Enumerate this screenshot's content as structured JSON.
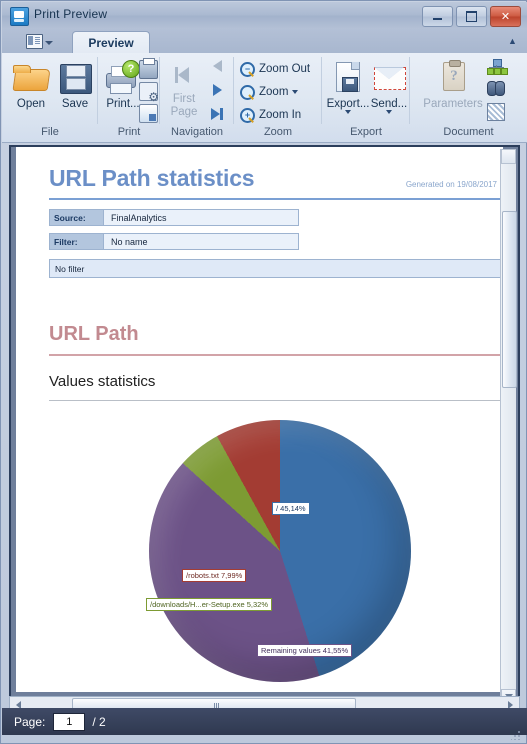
{
  "window": {
    "title": "Print Preview",
    "icon": "print-preview-icon",
    "minimize_label": "–",
    "maximize_label": "□",
    "close_label": "✕"
  },
  "ribbon": {
    "quick_access_icon": "document-layout-icon",
    "collapse_label": "▲",
    "tabs": [
      {
        "label": "Preview",
        "active": true
      }
    ],
    "groups": [
      {
        "name": "File",
        "label": "File",
        "buttons": [
          {
            "label": "Open",
            "icon": "open-folder-icon"
          },
          {
            "label": "Save",
            "icon": "floppy-disk-icon"
          }
        ]
      },
      {
        "name": "Print",
        "label": "Print",
        "buttons": [
          {
            "label": "Print...",
            "icon": "printer-icon"
          }
        ],
        "small_buttons": [
          {
            "icon": "quick-print-icon"
          },
          {
            "icon": "page-setup-gear-icon"
          },
          {
            "icon": "scale-icon"
          }
        ]
      },
      {
        "name": "Navigation",
        "label": "Navigation",
        "buttons": [
          {
            "label": "First Page",
            "icon": "first-page-icon",
            "disabled": true
          }
        ],
        "small_buttons": [
          {
            "icon": "previous-page-icon",
            "disabled": true
          },
          {
            "icon": "next-page-icon",
            "disabled": false
          },
          {
            "icon": "last-page-icon",
            "disabled": false
          }
        ]
      },
      {
        "name": "Zoom",
        "label": "Zoom",
        "rows": [
          {
            "label": "Zoom Out",
            "icon": "zoom-out-icon",
            "glyph": "−",
            "dropdown": false
          },
          {
            "label": "Zoom",
            "icon": "zoom-icon",
            "glyph": "",
            "dropdown": true
          },
          {
            "label": "Zoom In",
            "icon": "zoom-in-icon",
            "glyph": "+",
            "dropdown": false
          }
        ]
      },
      {
        "name": "Export",
        "label": "Export",
        "buttons": [
          {
            "label": "Export...",
            "icon": "export-document-icon",
            "dropdown": true
          },
          {
            "label": "Send...",
            "icon": "send-mail-icon",
            "dropdown": true
          }
        ]
      },
      {
        "name": "Document",
        "label": "Document",
        "buttons": [
          {
            "label": "Parameters",
            "icon": "parameters-clipboard-icon",
            "disabled": true
          }
        ],
        "small_buttons": [
          {
            "icon": "document-map-icon"
          },
          {
            "icon": "find-binoculars-icon"
          },
          {
            "icon": "watermark-icon"
          }
        ]
      }
    ]
  },
  "document": {
    "title": "URL Path statistics",
    "generated_on": "Generated on 19/08/2017",
    "fields": [
      {
        "label": "Source:",
        "value": "FinalAnalytics"
      },
      {
        "label": "Filter:",
        "value": "No name"
      }
    ],
    "filter_note": "No filter",
    "section_title": "URL Path",
    "subsection_title": "Values statistics"
  },
  "chart_data": {
    "type": "pie",
    "title": "URL Path",
    "subtitle": "Values statistics",
    "unit": "%",
    "decimal_separator": ",",
    "legend": "none",
    "labels_on_slices": true,
    "categories": [
      "/",
      "Remaining values",
      "/downloads/H...er-Setup.exe",
      "/robots.txt"
    ],
    "values": [
      45.14,
      41.55,
      5.32,
      7.99
    ],
    "colors": [
      "#3a6fa8",
      "#6c5287",
      "#7d9b33",
      "#a33c33"
    ],
    "slices": [
      {
        "label": "/",
        "value": 45.14,
        "text": "/  45,14%",
        "color": "#3a6fa8"
      },
      {
        "label": "Remaining values",
        "value": 41.55,
        "text": "Remaining values 41,55%",
        "color": "#6c5287"
      },
      {
        "label": "/downloads/H...er-Setup.exe",
        "value": 5.32,
        "text": "/downloads/H...er-Setup.exe 5,32%",
        "color": "#7d9b33"
      },
      {
        "label": "/robots.txt",
        "value": 7.99,
        "text": "/robots.txt 7,99%",
        "color": "#a33c33"
      }
    ]
  },
  "scrollbars": {
    "up_arrow": "▲",
    "down_arrow": "▼",
    "left_arrow": "◄",
    "right_arrow": "►"
  },
  "statusbar": {
    "page_label": "Page:",
    "page_value": "1",
    "page_total": "/ 2"
  }
}
